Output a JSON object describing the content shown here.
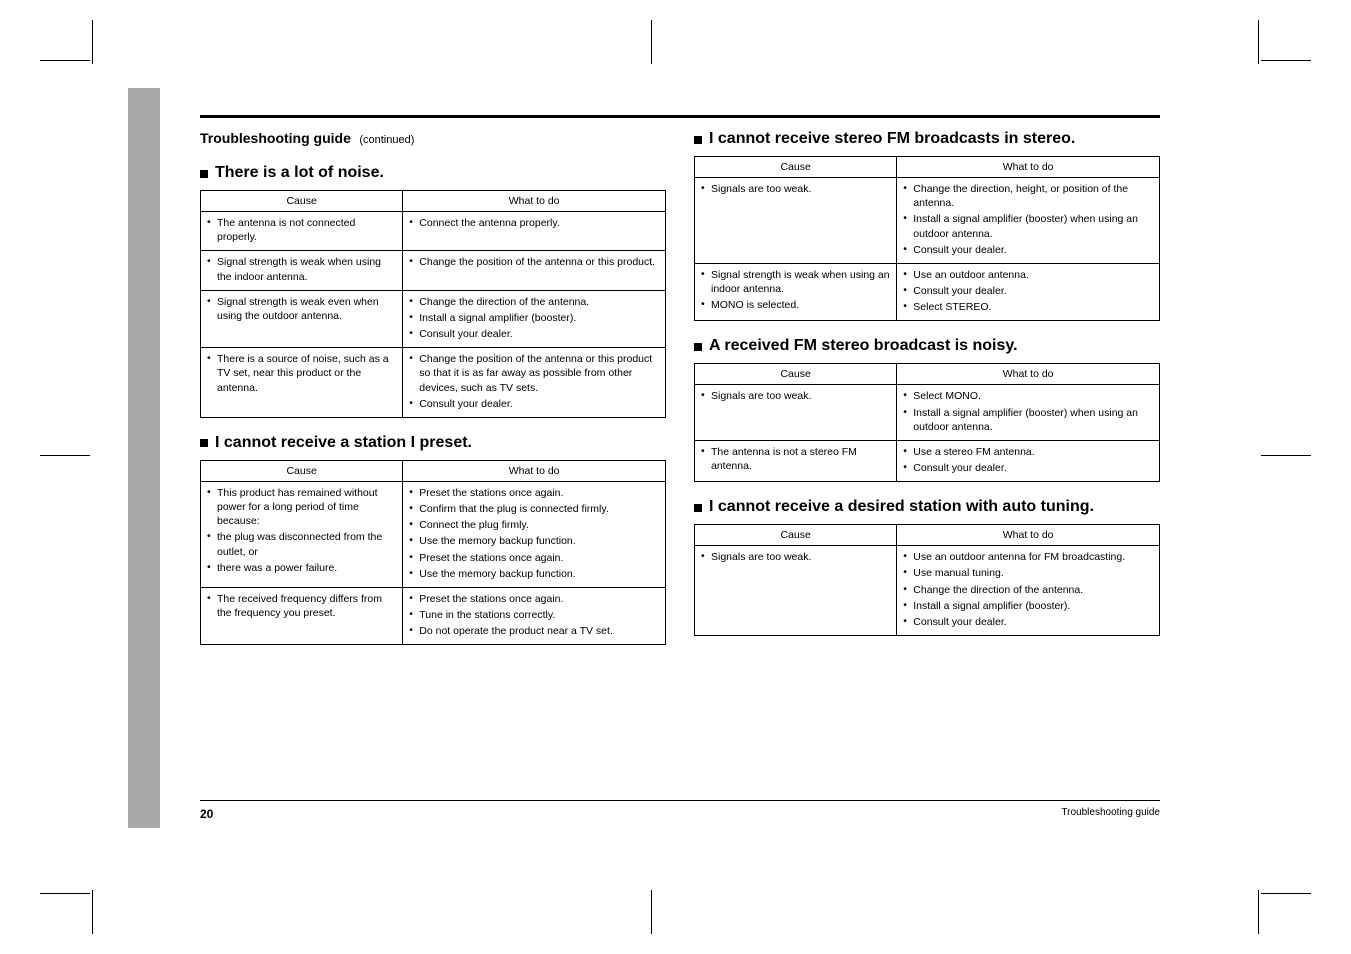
{
  "header": {
    "title": "Troubleshooting guide",
    "subtitle": "(continued)"
  },
  "sections": [
    {
      "heading": "There is a lot of noise.",
      "cols": [
        "Cause",
        "What to do"
      ],
      "rows": [
        {
          "cause": [
            "The antenna is not connected properly."
          ],
          "action": [
            "Connect the antenna properly."
          ]
        },
        {
          "cause": [
            "Signal strength is weak when using the indoor antenna."
          ],
          "action": [
            "Change the position of the antenna or this product."
          ]
        },
        {
          "cause": [
            "Signal strength is weak even when using the outdoor antenna."
          ],
          "action": [
            "Change the direction of the antenna.",
            "Install a signal amplifier (booster).",
            "Consult your dealer."
          ]
        },
        {
          "cause": [
            "There is a source of noise, such as a TV set, near this product or the antenna."
          ],
          "action": [
            "Change the position of the antenna or this product so that it is as far away as possible from other devices, such as TV sets.",
            "Consult your dealer."
          ]
        }
      ]
    },
    {
      "heading": "I cannot receive a station I preset.",
      "cols": [
        "Cause",
        "What to do"
      ],
      "rows": [
        {
          "cause": [
            "This product has remained without power for a long period of time because:",
            "the plug was disconnected from the outlet, or",
            "there was a power failure."
          ],
          "action": [
            "Preset the stations once again.",
            "Confirm that the plug is connected firmly.",
            "Connect the plug firmly.",
            "Use the memory backup function.",
            "Preset the stations once again.",
            "Use the memory backup function."
          ]
        },
        {
          "cause": [
            "The received frequency differs from the frequency you preset."
          ],
          "action": [
            "Preset the stations once again.",
            "Tune in the stations correctly.",
            "Do not operate the product near a TV set."
          ]
        }
      ]
    },
    {
      "heading": "I cannot receive stereo FM broadcasts in stereo.",
      "cols": [
        "Cause",
        "What to do"
      ],
      "rows": [
        {
          "cause": [
            "Signals are too weak."
          ],
          "action": [
            "Change the direction, height, or position of the antenna.",
            "Install a signal amplifier (booster) when using an outdoor antenna.",
            "Consult your dealer."
          ]
        },
        {
          "cause": [
            "Signal strength is weak when using an indoor antenna.",
            "MONO is selected."
          ],
          "action": [
            "Use an outdoor antenna.",
            "Consult your dealer.",
            "Select STEREO."
          ]
        }
      ]
    },
    {
      "heading": "A received FM stereo broadcast is noisy.",
      "cols": [
        "Cause",
        "What to do"
      ],
      "rows": [
        {
          "cause": [
            "Signals are too weak."
          ],
          "action": [
            "Select MONO.",
            "Install a signal amplifier (booster) when using an outdoor antenna."
          ]
        },
        {
          "cause": [
            "The antenna is not a stereo FM antenna."
          ],
          "action": [
            "Use a stereo FM antenna.",
            "Consult your dealer."
          ]
        }
      ]
    },
    {
      "heading": "I cannot receive a desired station with auto tuning.",
      "cols": [
        "Cause",
        "What to do"
      ],
      "rows": [
        {
          "cause": [
            "Signals are too weak."
          ],
          "action": [
            "Use an outdoor antenna for FM broadcasting.",
            "Use manual tuning.",
            "Change the direction of the antenna.",
            "Install a signal amplifier (booster).",
            "Consult your dealer."
          ]
        }
      ]
    }
  ],
  "footer": {
    "page": "20",
    "running": "Troubleshooting guide"
  }
}
